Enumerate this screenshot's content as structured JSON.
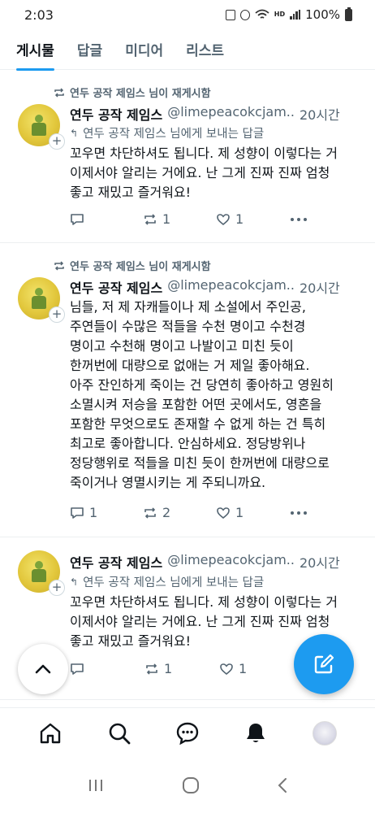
{
  "status_bar": {
    "time": "2:03",
    "network_label": "HD",
    "battery": "100%"
  },
  "tabs": [
    {
      "label": "게시물",
      "active": true
    },
    {
      "label": "답글",
      "active": false
    },
    {
      "label": "미디어",
      "active": false
    },
    {
      "label": "리스트",
      "active": false
    }
  ],
  "posts": [
    {
      "repost_label": "연두 공작 제임스 님이 재게시함",
      "author_name": "연두 공작 제임스",
      "handle": "@limepeacokcjam..",
      "time": "20시간",
      "reply_to": "연두 공작 제임스 님에게 보내는 답글",
      "body": "꼬우면 차단하셔도 됩니다. 제 성향이 이렇다는 거\n이제서야 알리는 거에요. 난 그게 진짜 진짜 엄청\n좋고 재밌고 즐거워요!",
      "replies": "",
      "reposts": "1",
      "likes": "1"
    },
    {
      "repost_label": "연두 공작 제임스 님이 재게시함",
      "author_name": "연두 공작 제임스",
      "handle": "@limepeacokcjam..",
      "time": "20시간",
      "reply_to": "",
      "body": "님들, 저 제 자캐들이나 제 소설에서 주인공,\n주연들이 수많은 적들을 수천 명이고 수천경\n명이고 수천해 명이고 나발이고 미친 듯이\n한꺼번에 대량으로 없애는 거 제일 좋아해요.\n아주 잔인하게 죽이는 건 당연히 좋아하고 영원히\n소멸시켜 저승을 포함한 어떤 곳에서도, 영혼을\n포함한 무엇으로도 존재할 수 없게 하는 건 특히\n최고로 좋아합니다. 안심하세요. 정당방위나\n정당행위로 적들을 미친 듯이 한꺼번에 대량으로\n죽이거나 영멸시키는 게 주되니까요.",
      "replies": "1",
      "reposts": "2",
      "likes": "1"
    },
    {
      "repost_label": "",
      "author_name": "연두 공작 제임스",
      "handle": "@limepeacokcjam..",
      "time": "20시간",
      "reply_to": "연두 공작 제임스 님에게 보내는 답글",
      "body": "꼬우면 차단하셔도 됩니다. 제 성향이 이렇다는 거\n이제서야 알리는 거에요. 난 그게 진짜 진짜 엄청\n좋고 재밌고 즐거워요!",
      "replies": "",
      "reposts": "1",
      "likes": "1"
    }
  ],
  "icons": {
    "repost": "repost-icon",
    "reply": "reply-icon",
    "like": "heart-icon",
    "more": "more-icon",
    "compose": "compose-icon",
    "scroll_top": "chevron-up-icon",
    "home": "home-icon",
    "search": "search-icon",
    "messages": "chat-icon",
    "notifications": "bell-icon"
  },
  "colors": {
    "accent": "#1d9bf0",
    "text": "#0f1419",
    "muted": "#536471",
    "divider": "#eceff1"
  }
}
